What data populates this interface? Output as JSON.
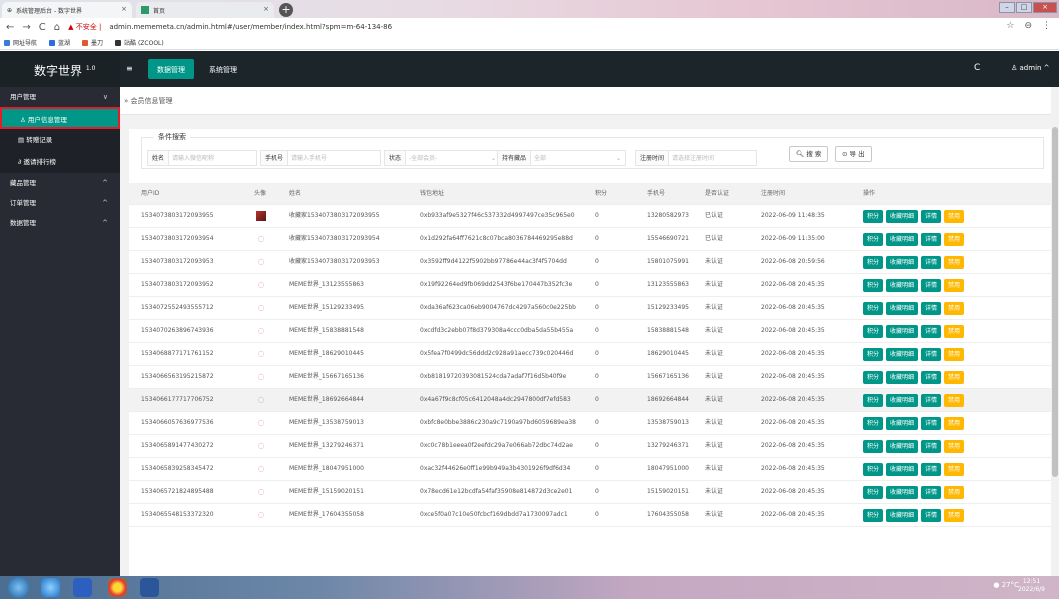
{
  "browser": {
    "tab1_title": "系统管理后台 - 数字世界",
    "tab2_title": "首页",
    "security_label": "不安全",
    "url": "admin.mememeta.cn/admin.html#/user/member/index.html?spm=m-64-134-86",
    "bookmarks": [
      "网址导航",
      "蓝湖",
      "墨刀",
      "站酷 (ZCOOL)"
    ]
  },
  "app": {
    "brand": "数字世界",
    "brand_version": "1.0",
    "top_nav": [
      "数据管理",
      "系统管理"
    ],
    "user": "admin"
  },
  "sidebar": {
    "groups": [
      {
        "label": "用户管理",
        "arrow": "∨"
      },
      {
        "label": "藏品管理",
        "arrow": "^"
      },
      {
        "label": "订单管理",
        "arrow": "^"
      },
      {
        "label": "数据管理",
        "arrow": "^"
      }
    ],
    "items": [
      "用户信息管理",
      "转赠记录",
      "邀请排行榜"
    ]
  },
  "breadcrumb": "会员信息管理",
  "filter": {
    "legend": "条件搜索",
    "name_label": "姓名",
    "name_placeholder": "请输入微信昵称",
    "phone_label": "手机号",
    "phone_placeholder": "请输入手机号",
    "status_label": "状态",
    "status_value": "-全部会员-",
    "holding_label": "持有藏品",
    "holding_value": "全部",
    "regtime_label": "注册时间",
    "regtime_placeholder": "请选择注册时间",
    "search_btn": "搜 索",
    "export_btn": "导 出"
  },
  "table": {
    "headers": [
      "用户ID",
      "头像",
      "姓名",
      "钱包地址",
      "积分",
      "手机号",
      "是否认证",
      "注册时间",
      "操作"
    ],
    "actions": [
      "积分",
      "收藏明细",
      "详情",
      "禁用"
    ],
    "rows": [
      {
        "id": "1534073803172093955",
        "avatar": "red",
        "name": "收藏家1534073803172093955",
        "wallet": "0xb933af9e5327f46c537332d4997497ce35c965e0",
        "points": "0",
        "phone": "13280582973",
        "auth": "已认证",
        "time": "2022-06-09 11:48:35"
      },
      {
        "id": "1534073803172093954",
        "avatar": "logo",
        "name": "收藏家1534073803172093954",
        "wallet": "0x1d292fa64ff7621c8c07bca8036784469295e88d",
        "points": "0",
        "phone": "15546690721",
        "auth": "已认证",
        "time": "2022-06-09 11:35:00"
      },
      {
        "id": "1534073803172093953",
        "avatar": "logo",
        "name": "收藏家1534073803172093953",
        "wallet": "0x3592ff9d4122f5902bb97786e44ac3f4f5704dd",
        "points": "0",
        "phone": "15801075991",
        "auth": "未认证",
        "time": "2022-06-08 20:59:56"
      },
      {
        "id": "1534073803172093952",
        "avatar": "logo",
        "name": "MEME世界_13123555863",
        "wallet": "0x19f92264ed9fb069dd2543f6be170447b352fc3e",
        "points": "0",
        "phone": "13123555863",
        "auth": "未认证",
        "time": "2022-06-08 20:45:35"
      },
      {
        "id": "1534072552493555712",
        "avatar": "logo",
        "name": "MEME世界_15129233495",
        "wallet": "0xda36af623ca06eb9004767dc4297a560c0e225bb",
        "points": "0",
        "phone": "15129233495",
        "auth": "未认证",
        "time": "2022-06-08 20:45:35"
      },
      {
        "id": "1534070263896743936",
        "avatar": "logo",
        "name": "MEME世界_15838881548",
        "wallet": "0xcdfd3c2ebb07f8d379308a4ccc0dba5da55b455a",
        "points": "0",
        "phone": "15838881548",
        "auth": "未认证",
        "time": "2022-06-08 20:45:35"
      },
      {
        "id": "1534068877171761152",
        "avatar": "logo",
        "name": "MEME世界_18629010445",
        "wallet": "0x5fea7f0499dc56ddd2c928a91aecc739c020446d",
        "points": "0",
        "phone": "18629010445",
        "auth": "未认证",
        "time": "2022-06-08 20:45:35"
      },
      {
        "id": "1534066563195215872",
        "avatar": "logo",
        "name": "MEME世界_15667165136",
        "wallet": "0xb81819720393081524cda7adaf7f16d5b40f9e",
        "points": "0",
        "phone": "15667165136",
        "auth": "未认证",
        "time": "2022-06-08 20:45:35"
      },
      {
        "id": "1534066177717706752",
        "avatar": "logo",
        "name": "MEME世界_18692664844",
        "wallet": "0x4a67f9c8cf05c6412048a4dc2947800df7efd583",
        "points": "0",
        "phone": "18692664844",
        "auth": "未认证",
        "time": "2022-06-08 20:45:35"
      },
      {
        "id": "1534066057636977536",
        "avatar": "logo",
        "name": "MEME世界_13538759013",
        "wallet": "0xbfc8e0bbe3886c230a9c7190a97bd6059689ea38",
        "points": "0",
        "phone": "13538759013",
        "auth": "未认证",
        "time": "2022-06-08 20:45:35"
      },
      {
        "id": "1534065891477430272",
        "avatar": "logo",
        "name": "MEME世界_13279246371",
        "wallet": "0xc0c78b1eeea0f2eefdc29a7e066ab72dbc74d2ae",
        "points": "0",
        "phone": "13279246371",
        "auth": "未认证",
        "time": "2022-06-08 20:45:35"
      },
      {
        "id": "1534065839258345472",
        "avatar": "logo",
        "name": "MEME世界_18047951000",
        "wallet": "0xac32f44626e0ff1e99b949a3b4301926f9df6d34",
        "points": "0",
        "phone": "18047951000",
        "auth": "未认证",
        "time": "2022-06-08 20:45:35"
      },
      {
        "id": "1534065721824895488",
        "avatar": "logo",
        "name": "MEME世界_15159020151",
        "wallet": "0x78ecd61e12bcdfa54faf35908e814872d3ce2e01",
        "points": "0",
        "phone": "15159020151",
        "auth": "未认证",
        "time": "2022-06-08 20:45:35"
      },
      {
        "id": "1534065548153372320",
        "avatar": "logo",
        "name": "MEME世界_17604355058",
        "wallet": "0xce5f0a07c10e50fcbcf169dbdd7a1730097adc1",
        "points": "0",
        "phone": "17604355058",
        "auth": "未认证",
        "time": "2022-06-08 20:45:35"
      }
    ]
  },
  "taskbar": {
    "temperature": "27°C",
    "time": "12:51",
    "date": "2022/6/9"
  },
  "colors": {
    "accent": "#009688",
    "warning": "#ffb800",
    "highlight_border": "#e31c2a",
    "sidebar_bg": "#282b33",
    "topbar_bg": "#1c2529"
  }
}
